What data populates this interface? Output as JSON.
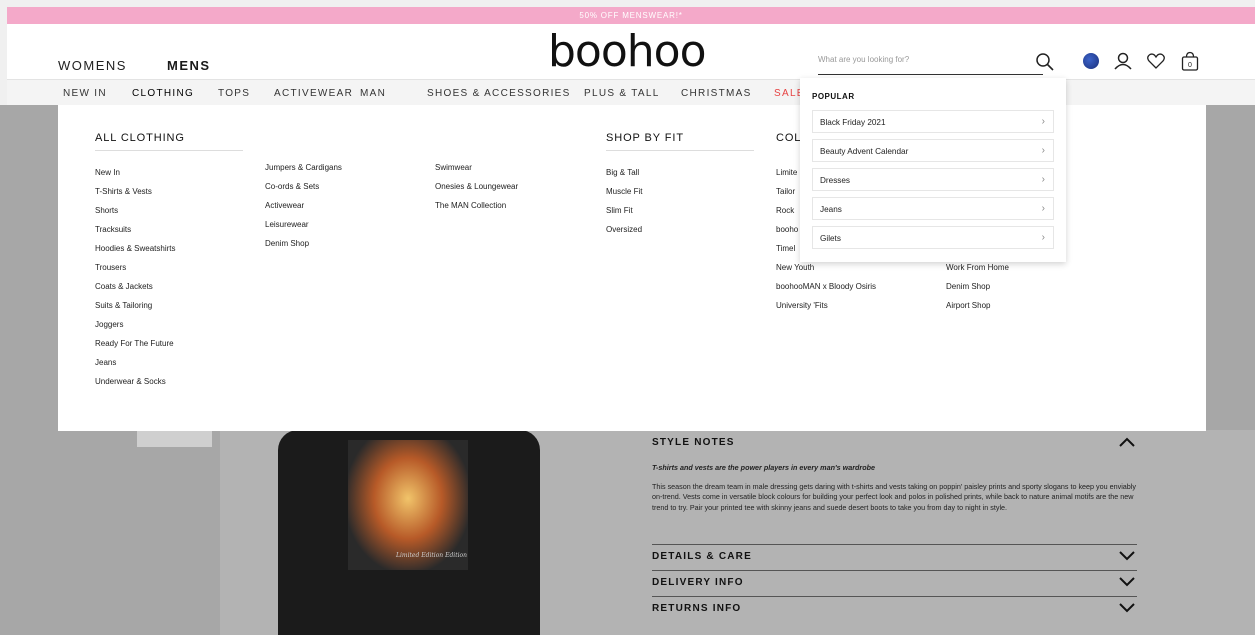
{
  "promo": {
    "text": "50% OFF MENSWEAR!*"
  },
  "header": {
    "womens": "WOMENS",
    "mens": "MENS",
    "logo": "boohoo",
    "search_placeholder": "What are you looking for?"
  },
  "nav": {
    "items": [
      "NEW IN",
      "CLOTHING",
      "TOPS",
      "ACTIVEWEAR",
      "MAN",
      "SHOES & ACCESSORIES",
      "PLUS & TALL",
      "CHRISTMAS",
      "SALE"
    ]
  },
  "menu": {
    "all_clothing": {
      "heading": "ALL CLOTHING",
      "col1": [
        "New In",
        "T-Shirts & Vests",
        "Shorts",
        "Tracksuits",
        "Hoodies & Sweatshirts",
        "Trousers",
        "Coats & Jackets",
        "Suits & Tailoring",
        "Joggers",
        "Ready For The Future",
        "Jeans",
        "Underwear & Socks"
      ],
      "col2": [
        "Jumpers & Cardigans",
        "Co-ords & Sets",
        "Activewear",
        "Leisurewear",
        "Denim Shop"
      ],
      "col3": [
        "Swimwear",
        "Onesies & Loungewear",
        "The MAN Collection"
      ]
    },
    "shop_by_fit": {
      "heading": "SHOP BY FIT",
      "items": [
        "Big & Tall",
        "Muscle Fit",
        "Slim Fit",
        "Oversized"
      ]
    },
    "collections": {
      "heading": "COL",
      "items": [
        "Limite",
        "Tailor",
        "Rock",
        "booho",
        "Timel",
        "New Youth",
        "boohooMAN x Bloody Osiris",
        "University 'Fits"
      ]
    },
    "extra": {
      "items": [
        "Work From Home",
        "Denim Shop",
        "Airport Shop"
      ]
    }
  },
  "dropdown": {
    "heading": "POPULAR",
    "items": [
      "Black Friday 2021",
      "Beauty Advent Calendar",
      "Dresses",
      "Jeans",
      "Gilets"
    ]
  },
  "product": {
    "print_text": "Limited Edition Edition",
    "style_notes": {
      "heading": "STYLE NOTES",
      "subheading": "T-shirts and vests are the power players in every man's wardrobe",
      "body": "This season the dream team in male dressing gets daring with t-shirts and vests taking on poppin' paisley prints and sporty slogans to keep you enviably on-trend. Vests come in versatile block colours for building your perfect look and polos in polished prints, while back to nature animal motifs are the new trend to try. Pair your printed tee with skinny jeans and suede desert boots to take you from day to night in style."
    },
    "details": "DETAILS & CARE",
    "delivery": "DELIVERY INFO",
    "returns": "RETURNS INFO"
  },
  "colors": {
    "promo_bg": "#f4a9c9",
    "sale": "#e64343",
    "overlay": "#a7a7a7"
  },
  "icons": [
    "search-icon",
    "globe-icon",
    "user-icon",
    "heart-icon",
    "bag-icon",
    "chevron-up-icon",
    "chevron-down-icon",
    "chevron-right-icon"
  ]
}
